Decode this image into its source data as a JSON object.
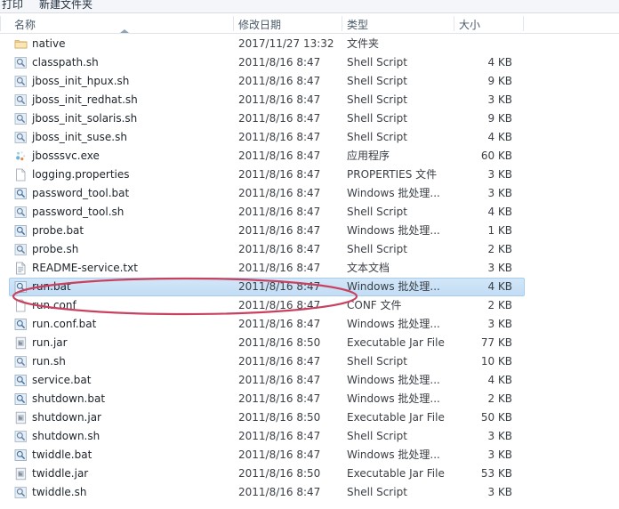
{
  "toolbar": {
    "print_label": "打印",
    "new_folder_label": "新建文件夹"
  },
  "columns": {
    "name": "名称",
    "date_modified": "修改日期",
    "type": "类型",
    "size": "大小",
    "sort_column": "名称",
    "sort_direction": "ascending"
  },
  "selection": {
    "selected_file": "run.bat",
    "highlight_color": "#c2ddf5",
    "border_color": "#a7cdee"
  },
  "annotation": {
    "shape": "ellipse",
    "color": "#c8415f",
    "target": "run.bat"
  },
  "files": [
    {
      "name": "native",
      "date": "2017/11/27 13:32",
      "type": "文件夹",
      "size": "",
      "icon": "folder-icon"
    },
    {
      "name": "classpath.sh",
      "date": "2011/8/16 8:47",
      "type": "Shell Script",
      "size": "4 KB",
      "icon": "shell-script-icon"
    },
    {
      "name": "jboss_init_hpux.sh",
      "date": "2011/8/16 8:47",
      "type": "Shell Script",
      "size": "9 KB",
      "icon": "shell-script-icon"
    },
    {
      "name": "jboss_init_redhat.sh",
      "date": "2011/8/16 8:47",
      "type": "Shell Script",
      "size": "3 KB",
      "icon": "shell-script-icon"
    },
    {
      "name": "jboss_init_solaris.sh",
      "date": "2011/8/16 8:47",
      "type": "Shell Script",
      "size": "9 KB",
      "icon": "shell-script-icon"
    },
    {
      "name": "jboss_init_suse.sh",
      "date": "2011/8/16 8:47",
      "type": "Shell Script",
      "size": "4 KB",
      "icon": "shell-script-icon"
    },
    {
      "name": "jbosssvc.exe",
      "date": "2011/8/16 8:47",
      "type": "应用程序",
      "size": "60 KB",
      "icon": "application-icon"
    },
    {
      "name": "logging.properties",
      "date": "2011/8/16 8:47",
      "type": "PROPERTIES 文件",
      "size": "3 KB",
      "icon": "blank-document-icon"
    },
    {
      "name": "password_tool.bat",
      "date": "2011/8/16 8:47",
      "type": "Windows 批处理...",
      "size": "3 KB",
      "icon": "batch-file-icon"
    },
    {
      "name": "password_tool.sh",
      "date": "2011/8/16 8:47",
      "type": "Shell Script",
      "size": "4 KB",
      "icon": "shell-script-icon"
    },
    {
      "name": "probe.bat",
      "date": "2011/8/16 8:47",
      "type": "Windows 批处理...",
      "size": "1 KB",
      "icon": "batch-file-icon"
    },
    {
      "name": "probe.sh",
      "date": "2011/8/16 8:47",
      "type": "Shell Script",
      "size": "2 KB",
      "icon": "shell-script-icon"
    },
    {
      "name": "README-service.txt",
      "date": "2011/8/16 8:47",
      "type": "文本文档",
      "size": "3 KB",
      "icon": "text-document-icon"
    },
    {
      "name": "run.bat",
      "date": "2011/8/16 8:47",
      "type": "Windows 批处理...",
      "size": "4 KB",
      "icon": "batch-file-icon",
      "selected": true
    },
    {
      "name": "run.conf",
      "date": "2011/8/16 8:47",
      "type": "CONF 文件",
      "size": "2 KB",
      "icon": "blank-document-icon"
    },
    {
      "name": "run.conf.bat",
      "date": "2011/8/16 8:47",
      "type": "Windows 批处理...",
      "size": "3 KB",
      "icon": "batch-file-icon"
    },
    {
      "name": "run.jar",
      "date": "2011/8/16 8:50",
      "type": "Executable Jar File",
      "size": "77 KB",
      "icon": "jar-file-icon"
    },
    {
      "name": "run.sh",
      "date": "2011/8/16 8:47",
      "type": "Shell Script",
      "size": "10 KB",
      "icon": "shell-script-icon"
    },
    {
      "name": "service.bat",
      "date": "2011/8/16 8:47",
      "type": "Windows 批处理...",
      "size": "4 KB",
      "icon": "batch-file-icon"
    },
    {
      "name": "shutdown.bat",
      "date": "2011/8/16 8:47",
      "type": "Windows 批处理...",
      "size": "2 KB",
      "icon": "batch-file-icon"
    },
    {
      "name": "shutdown.jar",
      "date": "2011/8/16 8:50",
      "type": "Executable Jar File",
      "size": "50 KB",
      "icon": "jar-file-icon"
    },
    {
      "name": "shutdown.sh",
      "date": "2011/8/16 8:47",
      "type": "Shell Script",
      "size": "3 KB",
      "icon": "shell-script-icon"
    },
    {
      "name": "twiddle.bat",
      "date": "2011/8/16 8:47",
      "type": "Windows 批处理...",
      "size": "3 KB",
      "icon": "batch-file-icon"
    },
    {
      "name": "twiddle.jar",
      "date": "2011/8/16 8:50",
      "type": "Executable Jar File",
      "size": "53 KB",
      "icon": "jar-file-icon"
    },
    {
      "name": "twiddle.sh",
      "date": "2011/8/16 8:47",
      "type": "Shell Script",
      "size": "3 KB",
      "icon": "shell-script-icon"
    }
  ]
}
